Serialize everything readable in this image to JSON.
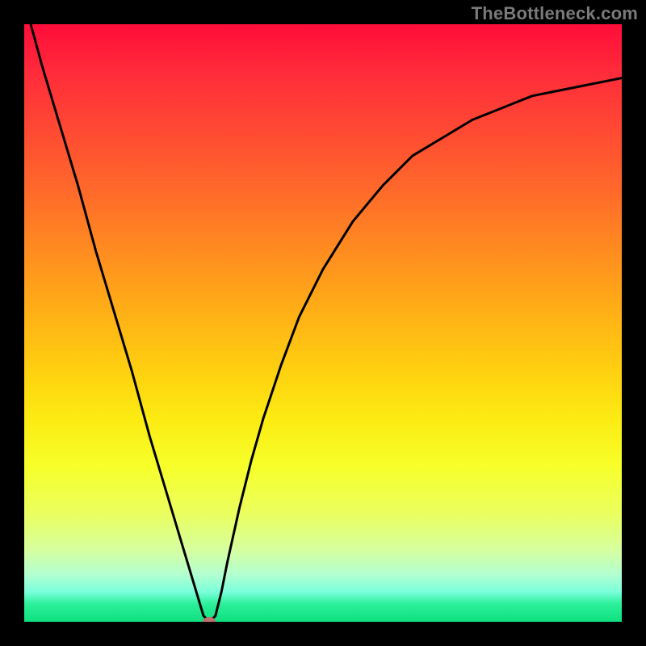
{
  "watermark": "TheBottleneck.com",
  "chart_data": {
    "type": "line",
    "title": "",
    "xlabel": "",
    "ylabel": "",
    "xlim": [
      0,
      100
    ],
    "ylim": [
      0,
      100
    ],
    "grid": false,
    "legend": false,
    "background": "red-yellow-green vertical gradient",
    "series": [
      {
        "name": "curve",
        "x": [
          0,
          3,
          6,
          9,
          12,
          15,
          18,
          21,
          24,
          27,
          30,
          31,
          32,
          33,
          34,
          36,
          38,
          40,
          43,
          46,
          50,
          55,
          60,
          65,
          70,
          75,
          80,
          85,
          90,
          95,
          100
        ],
        "y": [
          104,
          93,
          83,
          73,
          62,
          52,
          42,
          31,
          21,
          11,
          1,
          0,
          1,
          5,
          10,
          19,
          27,
          34,
          43,
          51,
          59,
          67,
          73,
          78,
          81,
          84,
          86,
          88,
          89,
          90,
          91
        ]
      }
    ],
    "marker": {
      "x": 31,
      "y": 0,
      "color": "#c27070"
    }
  },
  "colors": {
    "frame": "#000000",
    "watermark": "#7a7a7a",
    "curve": "#000000",
    "marker": "#c27070"
  }
}
